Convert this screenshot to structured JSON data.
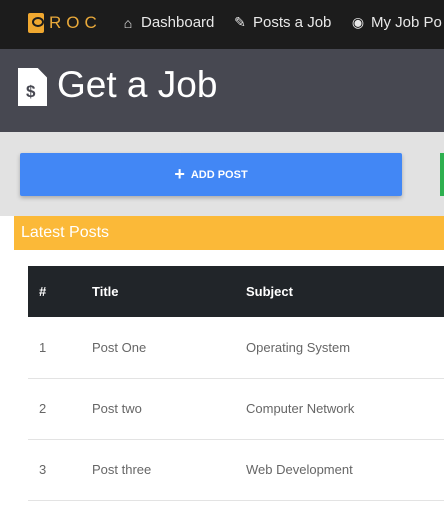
{
  "nav": {
    "brand": "ROC",
    "items": [
      {
        "label": "Dashboard",
        "icon": "home-icon"
      },
      {
        "label": "Posts a Job",
        "icon": "edit-icon"
      },
      {
        "label": "My Job Po",
        "icon": "eye-icon"
      }
    ]
  },
  "header": {
    "title": "Get a Job",
    "icon": "file-invoice-dollar-icon"
  },
  "actions": {
    "add_post": "ADD POST"
  },
  "latest": {
    "title": "Latest Posts"
  },
  "table": {
    "headers": [
      "#",
      "Title",
      "Subject"
    ],
    "rows": [
      [
        "1",
        "Post One",
        "Operating System"
      ],
      [
        "2",
        "Post two",
        "Computer Network"
      ],
      [
        "3",
        "Post three",
        "Web Development"
      ]
    ]
  },
  "colors": {
    "nav": "#1c1c1c",
    "header": "#474851",
    "accent": "#fbb938",
    "primary": "#4287f5",
    "success": "#2eb04f"
  }
}
